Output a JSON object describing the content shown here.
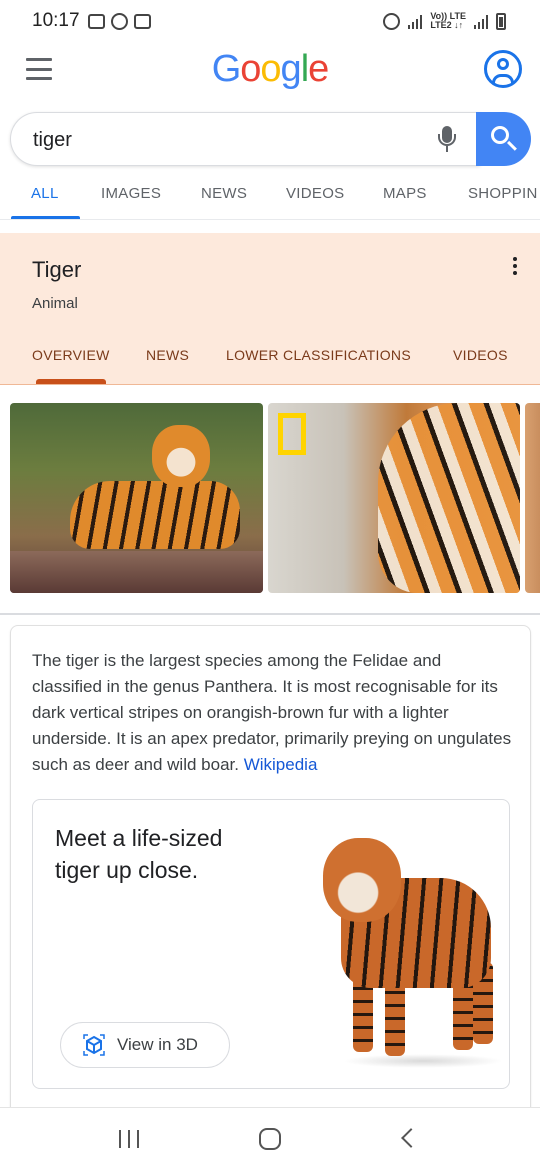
{
  "status_bar": {
    "time": "10:17",
    "network_line1": "Vo)) LTE",
    "network_line2": "LTE2 ↓↑"
  },
  "header": {
    "logo_letters": [
      {
        "char": "G",
        "color": "#4285f4"
      },
      {
        "char": "o",
        "color": "#ea4335"
      },
      {
        "char": "o",
        "color": "#fbbc05"
      },
      {
        "char": "g",
        "color": "#4285f4"
      },
      {
        "char": "l",
        "color": "#34a853"
      },
      {
        "char": "e",
        "color": "#ea4335"
      }
    ]
  },
  "search": {
    "query": "tiger",
    "button_color": "#4285f4"
  },
  "nav_tabs": [
    {
      "label": "ALL",
      "active": true
    },
    {
      "label": "IMAGES",
      "active": false
    },
    {
      "label": "NEWS",
      "active": false
    },
    {
      "label": "VIDEOS",
      "active": false
    },
    {
      "label": "MAPS",
      "active": false
    },
    {
      "label": "SHOPPIN",
      "active": false
    }
  ],
  "knowledge_panel": {
    "title": "Tiger",
    "subtitle": "Animal",
    "tabs": [
      {
        "label": "OVERVIEW",
        "active": true
      },
      {
        "label": "NEWS",
        "active": false
      },
      {
        "label": "LOWER CLASSIFICATIONS",
        "active": false
      },
      {
        "label": "VIDEOS",
        "active": false
      }
    ]
  },
  "description": {
    "text": "The tiger is the largest species among the Felidae and classified in the genus Panthera. It is most recognisable for its dark vertical stripes on orangish-brown fur with a lighter underside. It is an apex predator, primarily preying on ungulates such as deer and wild boar.",
    "source_link": "Wikipedia"
  },
  "ar_card": {
    "title": "Meet a life-sized tiger up close.",
    "button_label": "View in 3D"
  }
}
